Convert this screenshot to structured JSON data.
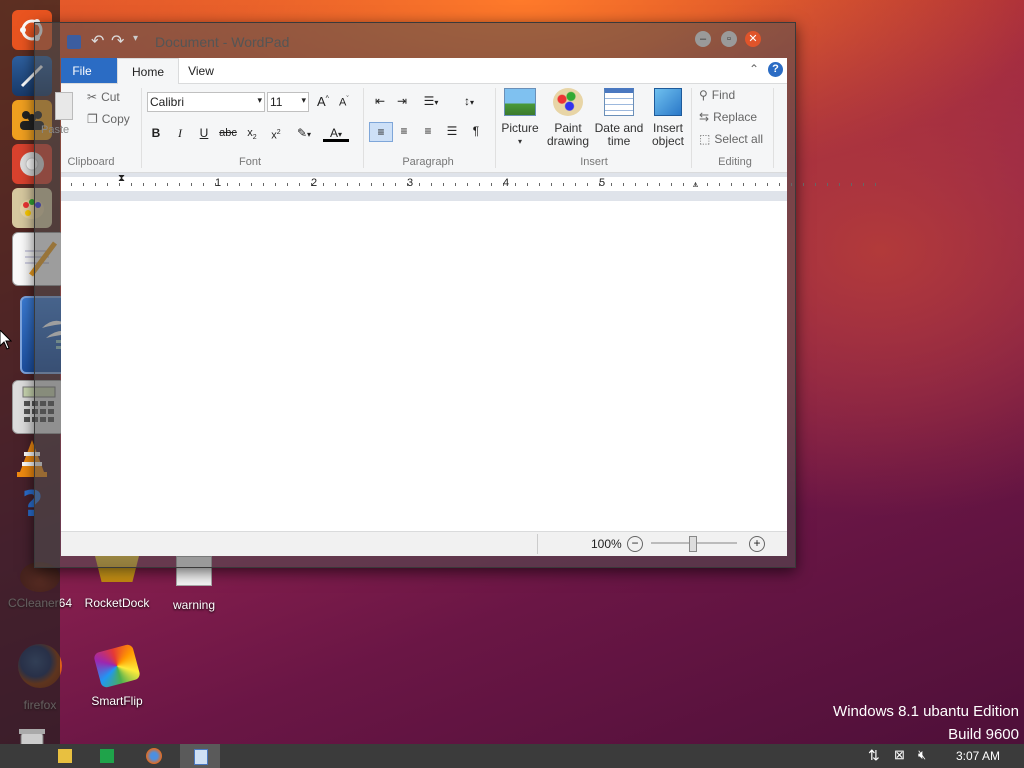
{
  "desktop": {
    "icons": [
      {
        "name": "CCleaner64",
        "label": "CCleaner64"
      },
      {
        "name": "RocketDock",
        "label": "RocketDock"
      },
      {
        "name": "warning",
        "label": "warning"
      },
      {
        "name": "firefox",
        "label": "firefox"
      },
      {
        "name": "SmartFlip",
        "label": "SmartFlip"
      }
    ],
    "watermark": {
      "line1": "Windows 8.1 ubantu Edition",
      "line2": "Build 9600"
    }
  },
  "launcher": {
    "icons": [
      "ubuntu-logo-icon",
      "paint-tool-icon",
      "people-icon",
      "chrome-icon",
      "paint-palette-icon",
      "notepad-pencil-icon",
      "openoffice-icon",
      "calculator-icon",
      "vlc-cone-icon",
      "help-question-icon",
      "trash-icon"
    ]
  },
  "window": {
    "title": "Document - WordPad",
    "tabs": {
      "file": "File",
      "home": "Home",
      "view": "View"
    },
    "clipboard": {
      "paste": "Paste",
      "cut": "Cut",
      "copy": "Copy",
      "label": "Clipboard"
    },
    "font": {
      "family": "Calibri",
      "size": "11",
      "label": "Font"
    },
    "paragraph": {
      "label": "Paragraph"
    },
    "insert": {
      "picture_l1": "Picture",
      "paint_l1": "Paint",
      "paint_l2": "drawing",
      "date_l1": "Date and",
      "date_l2": "time",
      "object_l1": "Insert",
      "object_l2": "object",
      "label": "Insert"
    },
    "editing": {
      "find": "Find",
      "replace": "Replace",
      "select_all": "Select all",
      "label": "Editing"
    },
    "ruler": {
      "numbers": [
        "1",
        "2",
        "3",
        "4",
        "5"
      ]
    },
    "status": {
      "zoom": "100%"
    }
  },
  "taskbar": {
    "clock": "3:07 AM"
  }
}
